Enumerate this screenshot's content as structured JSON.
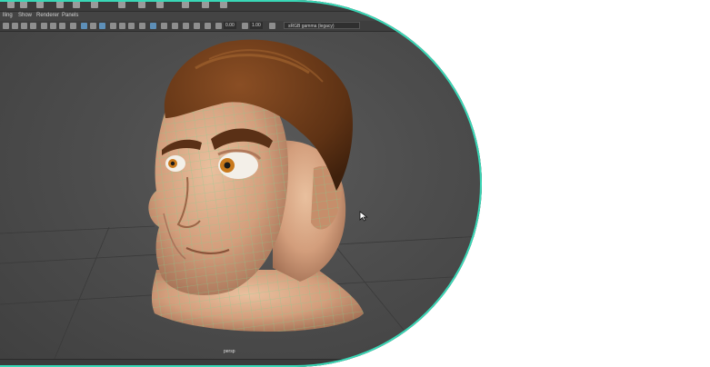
{
  "menu": {
    "items": [
      "lling",
      "Show",
      "Renderer",
      "Panels"
    ]
  },
  "toolbar": {
    "value_a": "0.00",
    "value_b": "1.00",
    "color_space": "sRGB gamma (legacy)"
  },
  "viewport": {
    "camera_label": "persp"
  },
  "colors": {
    "frame_border": "#39d7b6",
    "viewport_bg": "#4d4d4d",
    "skin": "#d9a583",
    "hair": "#6b3a1a",
    "wireframe": "#7fd08f"
  },
  "icons": [
    "mouse-cursor-icon",
    "select-tool-icon",
    "move-tool-icon",
    "rotate-tool-icon",
    "scale-tool-icon"
  ]
}
